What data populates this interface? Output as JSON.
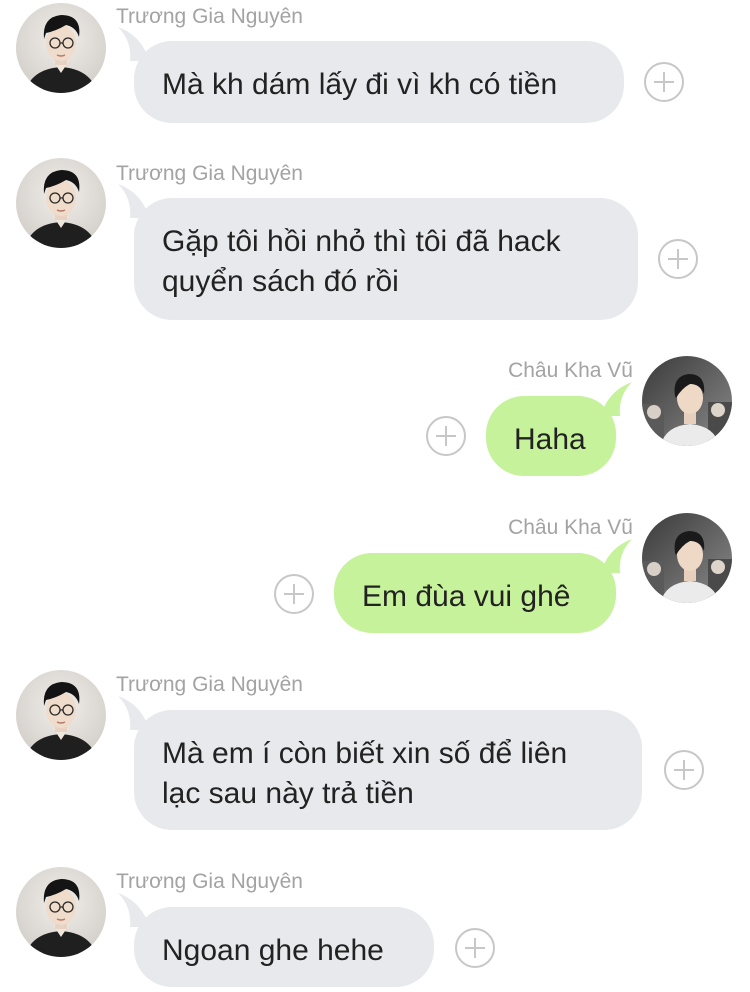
{
  "contacts": {
    "other": {
      "name": "Trương Gia Nguyên",
      "avatar_icon": "profile-photo-glasses"
    },
    "self": {
      "name": "Châu Kha Vũ",
      "avatar_icon": "profile-photo"
    }
  },
  "colors": {
    "incoming_bubble": "#e8e9ed",
    "outgoing_bubble": "#c6f29b",
    "sender_name": "#a3a3a3",
    "add_icon": "#c7c7c7"
  },
  "messages": [
    {
      "sender": "Trương Gia Nguyên",
      "direction": "incoming",
      "lines": [
        "Mà kh dám lấy đi vì kh có tiền"
      ],
      "action_icon": "add-reaction-icon"
    },
    {
      "sender": "Trương Gia Nguyên",
      "direction": "incoming",
      "lines": [
        "Gặp tôi hồi nhỏ thì tôi đã hack",
        "quyển sách đó rồi"
      ],
      "action_icon": "add-reaction-icon"
    },
    {
      "sender": "Châu Kha Vũ",
      "direction": "outgoing",
      "lines": [
        "Haha"
      ],
      "action_icon": "add-reaction-icon"
    },
    {
      "sender": "Châu Kha Vũ",
      "direction": "outgoing",
      "lines": [
        "Em đùa vui ghê"
      ],
      "action_icon": "add-reaction-icon"
    },
    {
      "sender": "Trương Gia Nguyên",
      "direction": "incoming",
      "lines": [
        "Mà em í còn biết xin số để liên",
        "lạc sau này trả tiền"
      ],
      "action_icon": "add-reaction-icon"
    },
    {
      "sender": "Trương Gia Nguyên",
      "direction": "incoming",
      "lines": [
        "Ngoan ghe hehe"
      ],
      "action_icon": "add-reaction-icon"
    }
  ]
}
